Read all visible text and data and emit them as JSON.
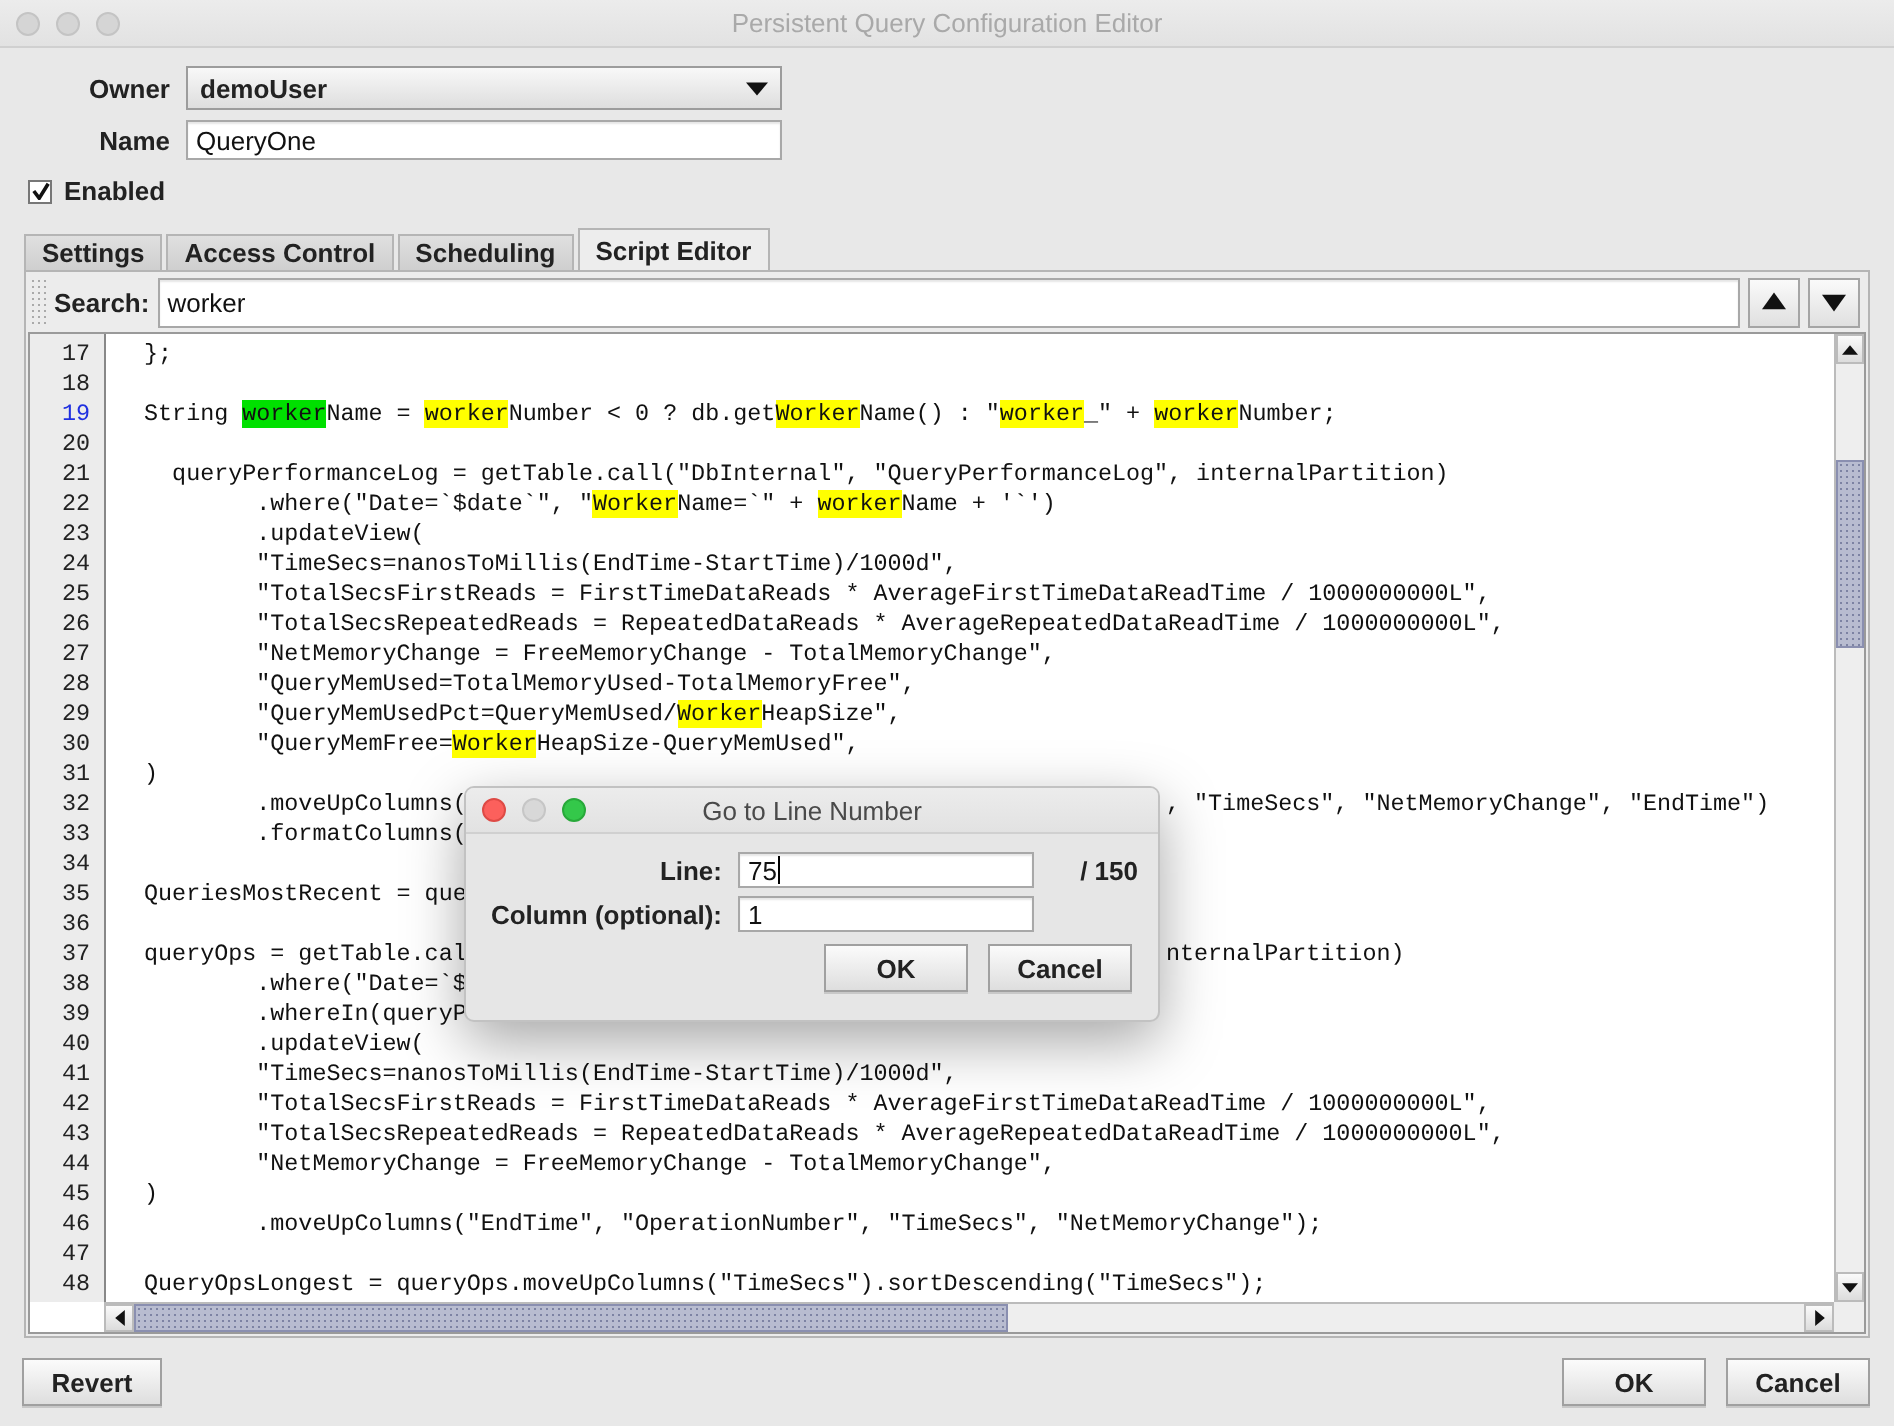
{
  "window": {
    "title": "Persistent Query Configuration Editor"
  },
  "form": {
    "owner_label": "Owner",
    "owner_value": "demoUser",
    "name_label": "Name",
    "name_value": "QueryOne",
    "enabled_label": "Enabled",
    "enabled": true
  },
  "tabs": [
    {
      "label": "Settings",
      "selected": false
    },
    {
      "label": "Access Control",
      "selected": false
    },
    {
      "label": "Scheduling",
      "selected": false
    },
    {
      "label": "Script Editor",
      "selected": true
    }
  ],
  "search": {
    "label": "Search:",
    "value": "worker"
  },
  "editor": {
    "lines": [
      {
        "number": "17",
        "current": false,
        "text": "  };"
      },
      {
        "number": "18",
        "current": false
      },
      {
        "number": "19",
        "current": true,
        "segments": [
          {
            "text": "  String ",
            "kind": "plain"
          },
          {
            "text": "worker",
            "kind": "current"
          },
          {
            "text": "Name = ",
            "kind": "plain"
          },
          {
            "text": "worker",
            "kind": "match"
          },
          {
            "text": "Number < 0 ? db.get",
            "kind": "plain"
          },
          {
            "text": "Worker",
            "kind": "match"
          },
          {
            "text": "Name() : \"",
            "kind": "plain"
          },
          {
            "text": "worker",
            "kind": "match"
          },
          {
            "text": "_\" + ",
            "kind": "plain"
          },
          {
            "text": "worker",
            "kind": "match"
          },
          {
            "text": "Number;",
            "kind": "plain"
          }
        ]
      },
      {
        "number": "20",
        "current": false
      },
      {
        "number": "21",
        "current": false,
        "text": "    queryPerformanceLog = getTable.call(\"DbInternal\", \"QueryPerformanceLog\", internalPartition)"
      },
      {
        "number": "22",
        "current": false,
        "segments": [
          {
            "text": "          .where(\"Date=`$date`\", \"",
            "kind": "plain"
          },
          {
            "text": "Worker",
            "kind": "match"
          },
          {
            "text": "Name=`\" + ",
            "kind": "plain"
          },
          {
            "text": "worker",
            "kind": "match"
          },
          {
            "text": "Name + '`')",
            "kind": "plain"
          }
        ]
      },
      {
        "number": "23",
        "current": false,
        "text": "          .updateView("
      },
      {
        "number": "24",
        "current": false,
        "text": "          \"TimeSecs=nanosToMillis(EndTime-StartTime)/1000d\","
      },
      {
        "number": "25",
        "current": false,
        "text": "          \"TotalSecsFirstReads = FirstTimeDataReads * AverageFirstTimeDataReadTime / 1000000000L\","
      },
      {
        "number": "26",
        "current": false,
        "text": "          \"TotalSecsRepeatedReads = RepeatedDataReads * AverageRepeatedDataReadTime / 1000000000L\","
      },
      {
        "number": "27",
        "current": false,
        "text": "          \"NetMemoryChange = FreeMemoryChange - TotalMemoryChange\","
      },
      {
        "number": "28",
        "current": false,
        "text": "          \"QueryMemUsed=TotalMemoryUsed-TotalMemoryFree\","
      },
      {
        "number": "29",
        "current": false,
        "segments": [
          {
            "text": "          \"QueryMemUsedPct=QueryMemUsed/",
            "kind": "plain"
          },
          {
            "text": "Worker",
            "kind": "match"
          },
          {
            "text": "HeapSize\",",
            "kind": "plain"
          }
        ]
      },
      {
        "number": "30",
        "current": false,
        "segments": [
          {
            "text": "          \"QueryMemFree=",
            "kind": "plain"
          },
          {
            "text": "Worker",
            "kind": "match"
          },
          {
            "text": "HeapSize-QueryMemUsed\",",
            "kind": "plain"
          }
        ]
      },
      {
        "number": "31",
        "current": false,
        "text": "  )"
      },
      {
        "number": "32",
        "current": false,
        "text": "          .moveUpColumns(",
        "text_right": ", \"TimeSecs\", \"NetMemoryChange\", \"EndTime\")"
      },
      {
        "number": "33",
        "current": false,
        "text": "          .formatColumns("
      },
      {
        "number": "34",
        "current": false
      },
      {
        "number": "35",
        "current": false,
        "text": "  QueriesMostRecent = que"
      },
      {
        "number": "36",
        "current": false
      },
      {
        "number": "37",
        "current": false,
        "text": "  queryOps = getTable.cal",
        "text_right": "nternalPartition)"
      },
      {
        "number": "38",
        "current": false,
        "text": "          .where(\"Date=`$"
      },
      {
        "number": "39",
        "current": false,
        "text": "          .whereIn(queryP"
      },
      {
        "number": "40",
        "current": false,
        "text": "          .updateView("
      },
      {
        "number": "41",
        "current": false,
        "text": "          \"TimeSecs=nanosToMillis(EndTime-StartTime)/1000d\","
      },
      {
        "number": "42",
        "current": false,
        "text": "          \"TotalSecsFirstReads = FirstTimeDataReads * AverageFirstTimeDataReadTime / 1000000000L\","
      },
      {
        "number": "43",
        "current": false,
        "text": "          \"TotalSecsRepeatedReads = RepeatedDataReads * AverageRepeatedDataReadTime / 1000000000L\","
      },
      {
        "number": "44",
        "current": false,
        "text": "          \"NetMemoryChange = FreeMemoryChange - TotalMemoryChange\","
      },
      {
        "number": "45",
        "current": false,
        "text": "  )"
      },
      {
        "number": "46",
        "current": false,
        "text": "          .moveUpColumns(\"EndTime\", \"OperationNumber\", \"TimeSecs\", \"NetMemoryChange\");"
      },
      {
        "number": "47",
        "current": false
      },
      {
        "number": "48",
        "current": false,
        "text": "  QueryOpsLongest = queryOps.moveUpColumns(\"TimeSecs\").sortDescending(\"TimeSecs\");"
      }
    ]
  },
  "dialog": {
    "title": "Go to Line Number",
    "line_label": "Line:",
    "line_value": "75",
    "line_total": "/ 150",
    "column_label": "Column (optional):",
    "column_value": "1",
    "buttons": [
      "OK",
      "Cancel"
    ]
  },
  "footer": {
    "left_button": "Revert",
    "right_buttons": [
      "OK",
      "Cancel"
    ]
  }
}
